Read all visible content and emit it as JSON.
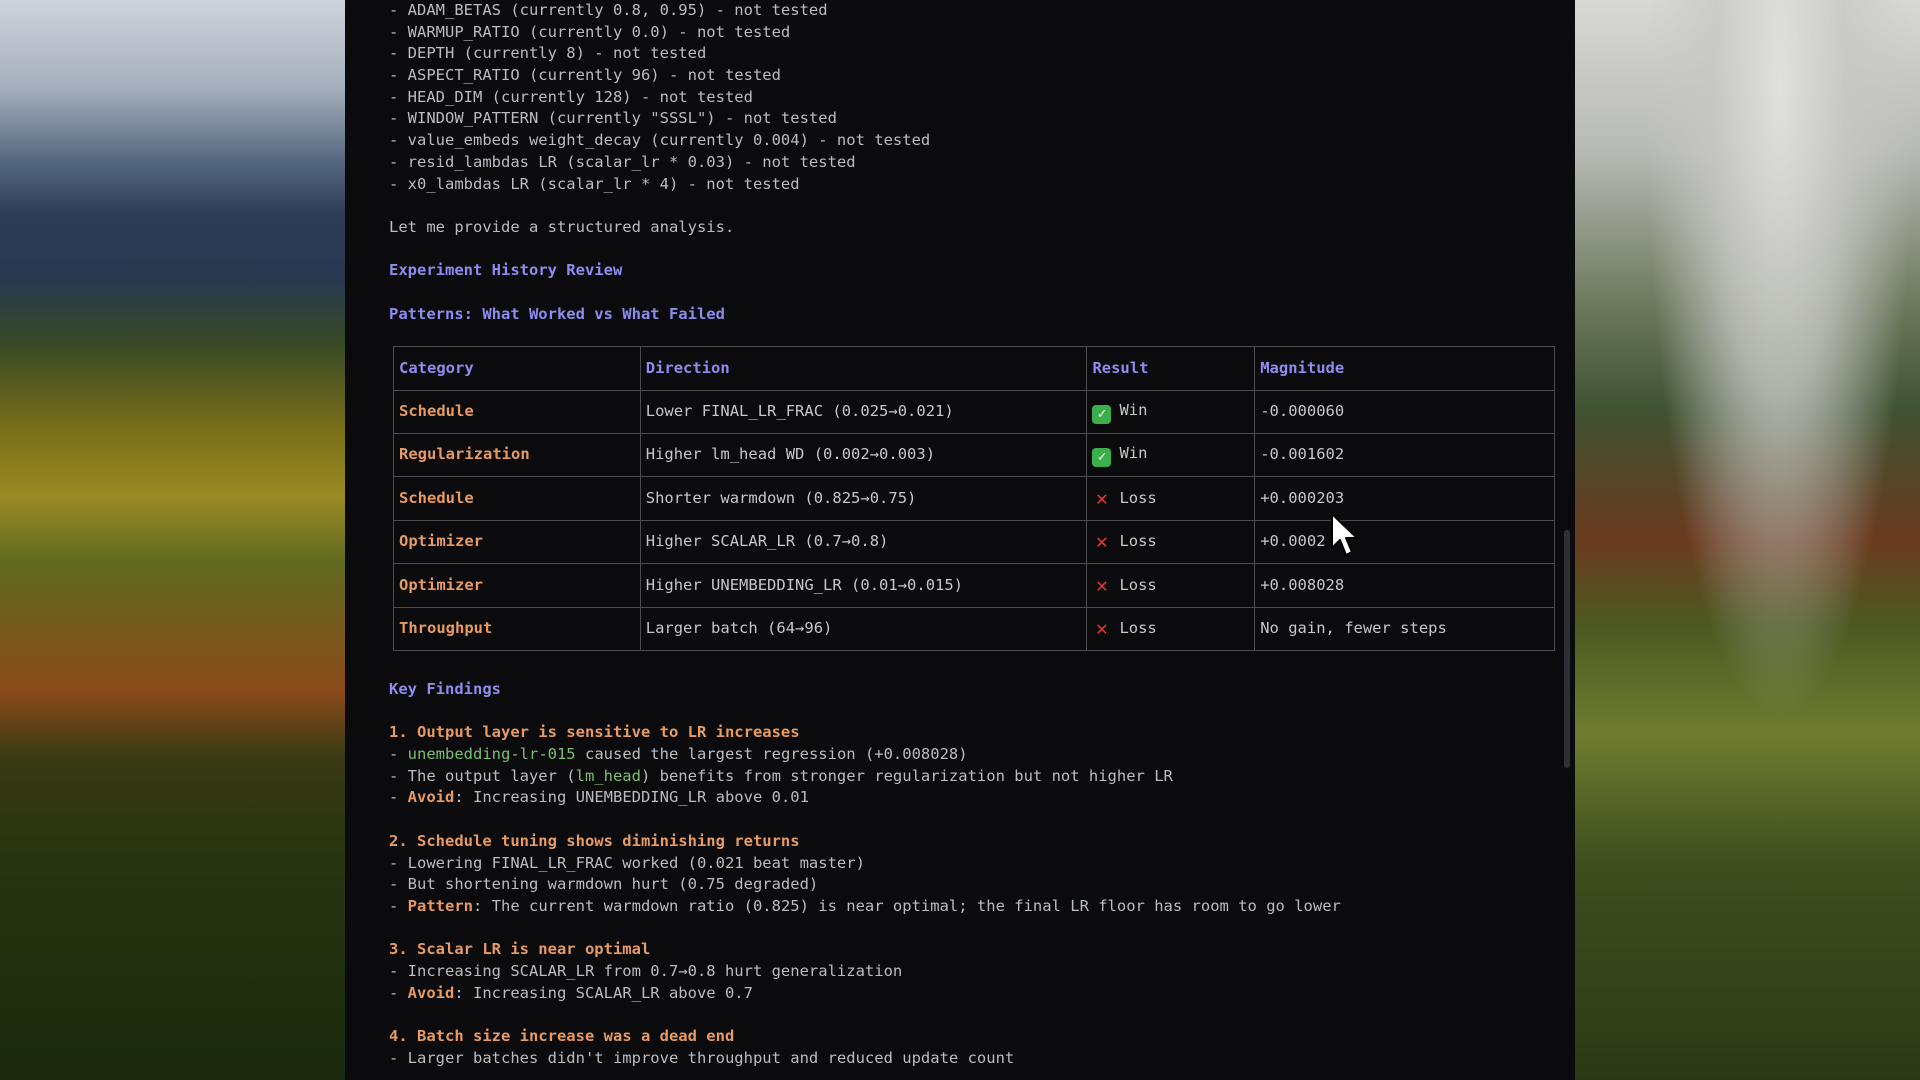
{
  "top_lines": [
    "- ADAM_BETAS (currently 0.8, 0.95) - not tested",
    "- WARMUP_RATIO (currently 0.0) - not tested",
    "- DEPTH (currently 8) - not tested",
    "- ASPECT_RATIO (currently 96) - not tested",
    "- HEAD_DIM (currently 128) - not tested",
    "- WINDOW_PATTERN (currently \"SSSL\") - not tested",
    "- value_embeds weight_decay (currently 0.004) - not tested",
    "- resid_lambdas LR (scalar_lr * 0.03) - not tested",
    "- x0_lambdas LR (scalar_lr * 4) - not tested"
  ],
  "intro": "Let me provide a structured analysis.",
  "history_heading": "Experiment History Review",
  "patterns_heading": "Patterns: What Worked vs What Failed",
  "table": {
    "headers": [
      "Category",
      "Direction",
      "Result",
      "Magnitude"
    ],
    "rows": [
      {
        "category": "Schedule",
        "direction": "Lower FINAL_LR_FRAC (0.025→0.021)",
        "result": "Win",
        "icon": "check-icon",
        "magnitude": "-0.000060"
      },
      {
        "category": "Regularization",
        "direction": "Higher lm_head WD (0.002→0.003)",
        "result": "Win",
        "icon": "check-icon",
        "magnitude": "-0.001602"
      },
      {
        "category": "Schedule",
        "direction": "Shorter warmdown (0.825→0.75)",
        "result": "Loss",
        "icon": "cross-icon",
        "magnitude": "+0.000203"
      },
      {
        "category": "Optimizer",
        "direction": "Higher SCALAR_LR (0.7→0.8)",
        "result": "Loss",
        "icon": "cross-icon",
        "magnitude": "+0.0002"
      },
      {
        "category": "Optimizer",
        "direction": "Higher UNEMBEDDING_LR (0.01→0.015)",
        "result": "Loss",
        "icon": "cross-icon",
        "magnitude": "+0.008028"
      },
      {
        "category": "Throughput",
        "direction": "Larger batch (64→96)",
        "result": "Loss",
        "icon": "cross-icon",
        "magnitude": "No gain, fewer steps"
      }
    ]
  },
  "key_findings_heading": "Key Findings",
  "findings": {
    "f1_title": "1. Output layer is sensitive to LR increases",
    "f1_l1_dash": "- ",
    "f1_l1_code": "unembedding-lr-015",
    "f1_l1_rest": " caused the largest regression (+0.008028)",
    "f1_l2_pre": "- The output layer (",
    "f1_l2_code": "lm_head",
    "f1_l2_rest": ") benefits from stronger regularization but not higher LR",
    "f1_l3_dash": "- ",
    "f1_l3_label": "Avoid",
    "f1_l3_rest": ": Increasing UNEMBEDDING_LR above 0.01",
    "f2_title": "2. Schedule tuning shows diminishing returns",
    "f2_l1": "- Lowering FINAL_LR_FRAC worked (0.021 beat master)",
    "f2_l2": "- But shortening warmdown hurt (0.75 degraded)",
    "f2_l3_dash": "- ",
    "f2_l3_label": "Pattern",
    "f2_l3_rest": ": The current warmdown ratio (0.825) is near optimal; the final LR floor has room to go lower",
    "f3_title": "3. Scalar LR is near optimal",
    "f3_l1": "- Increasing SCALAR_LR from 0.7→0.8 hurt generalization",
    "f3_l2_dash": "- ",
    "f3_l2_label": "Avoid",
    "f3_l2_rest": ": Increasing SCALAR_LR above 0.7",
    "f4_title": "4. Batch size increase was a dead end",
    "f4_l1": "- Larger batches didn't improve throughput and reduced update count"
  },
  "colors": {
    "terminal_bg": "#0b0b0d",
    "heading": "#8f8cf0",
    "accent": "#e79a62",
    "code": "#7cbf72",
    "win": "#3bb04a",
    "loss": "#e0392f"
  }
}
